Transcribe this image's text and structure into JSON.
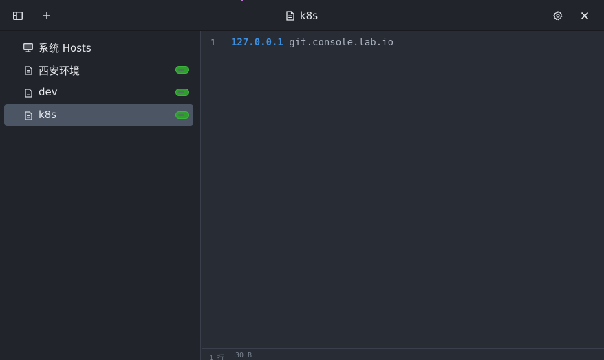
{
  "window": {
    "title": "k8s"
  },
  "toolbar": {
    "sidebar_toggle_icon": "sidebar-panel-icon",
    "add_icon": "plus-icon",
    "settings_icon": "gear-icon",
    "close_icon": "close-icon"
  },
  "sidebar": {
    "items": [
      {
        "label": "系统 Hosts",
        "icon": "monitor-icon",
        "toggle": false,
        "active": false
      },
      {
        "label": "西安环境",
        "icon": "file-icon",
        "toggle": true,
        "enabled": true,
        "active": false
      },
      {
        "label": "dev",
        "icon": "file-icon",
        "toggle": true,
        "enabled": true,
        "active": false
      },
      {
        "label": "k8s",
        "icon": "file-icon",
        "toggle": true,
        "enabled": true,
        "active": true
      }
    ]
  },
  "editor": {
    "lines": [
      {
        "number": "1",
        "ip": "127.0.0.1",
        "host": "git.console.lab.io"
      }
    ]
  },
  "status": {
    "lines": "1 行",
    "size": "30 B"
  },
  "colors": {
    "background": "#282c34",
    "sidebar": "#21252b",
    "active_item": "#4b5563",
    "toggle_on": "#2f9e2f",
    "ip": "#3d8fe0"
  }
}
